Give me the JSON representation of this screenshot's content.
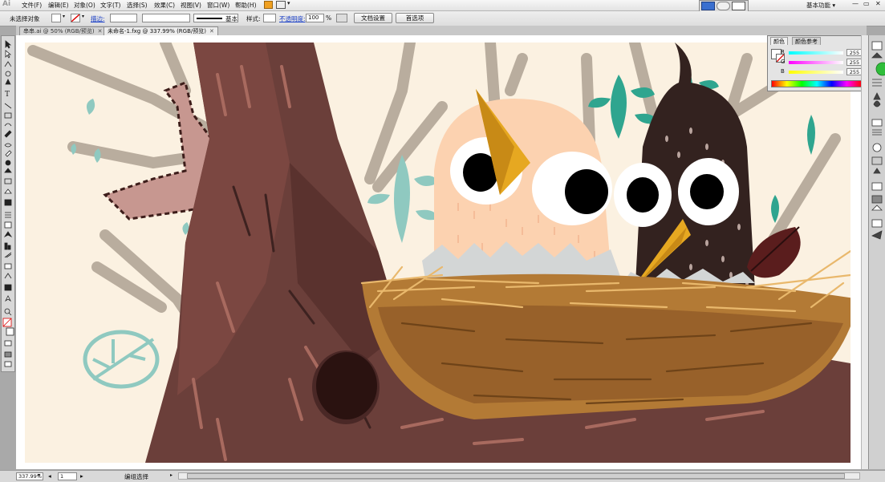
{
  "app": {
    "logo": "Ai"
  },
  "menu": [
    {
      "label": "文件(F)"
    },
    {
      "label": "编辑(E)"
    },
    {
      "label": "对象(O)"
    },
    {
      "label": "文字(T)"
    },
    {
      "label": "选择(S)"
    },
    {
      "label": "效果(C)"
    },
    {
      "label": "视图(V)"
    },
    {
      "label": "窗口(W)"
    },
    {
      "label": "帮助(H)"
    }
  ],
  "workspace": {
    "label": "基本功能 ▾"
  },
  "control_bar": {
    "selection_status": "未选择对象",
    "stroke_link": "描边:",
    "stroke_profile": "基本",
    "style_label": "样式:",
    "opacity_link": "不透明度:",
    "opacity_value": "100",
    "opacity_unit": "%",
    "doc_setup_button": "文档设置",
    "preferences_button": "首选项"
  },
  "tabs": [
    {
      "label": "串串.ai @ 50% (RGB/预览)",
      "active": false
    },
    {
      "label": "未命名-1.fxg @ 337.99% (RGB/预览)",
      "active": true
    }
  ],
  "color_panel": {
    "tabs": [
      "颜色",
      "颜色参考"
    ],
    "sliders": [
      {
        "label": "R",
        "value": "255",
        "color": "#e03030"
      },
      {
        "label": "G",
        "value": "255",
        "color": "#30c030"
      },
      {
        "label": "B",
        "value": "255",
        "color": "#3040e0"
      }
    ]
  },
  "status_bar": {
    "zoom": "337.99%",
    "artboard": "1",
    "mode": "编组选择"
  },
  "artwork": {
    "background": "#fbf1e1",
    "trunk_color": "#6b3f3a",
    "nest_color": "#b37a35",
    "chick_left_color": "#fcd2b0",
    "chick_right_color": "#33221f",
    "beak_color": "#e6a821",
    "leaf_color": "#2fa58f"
  }
}
